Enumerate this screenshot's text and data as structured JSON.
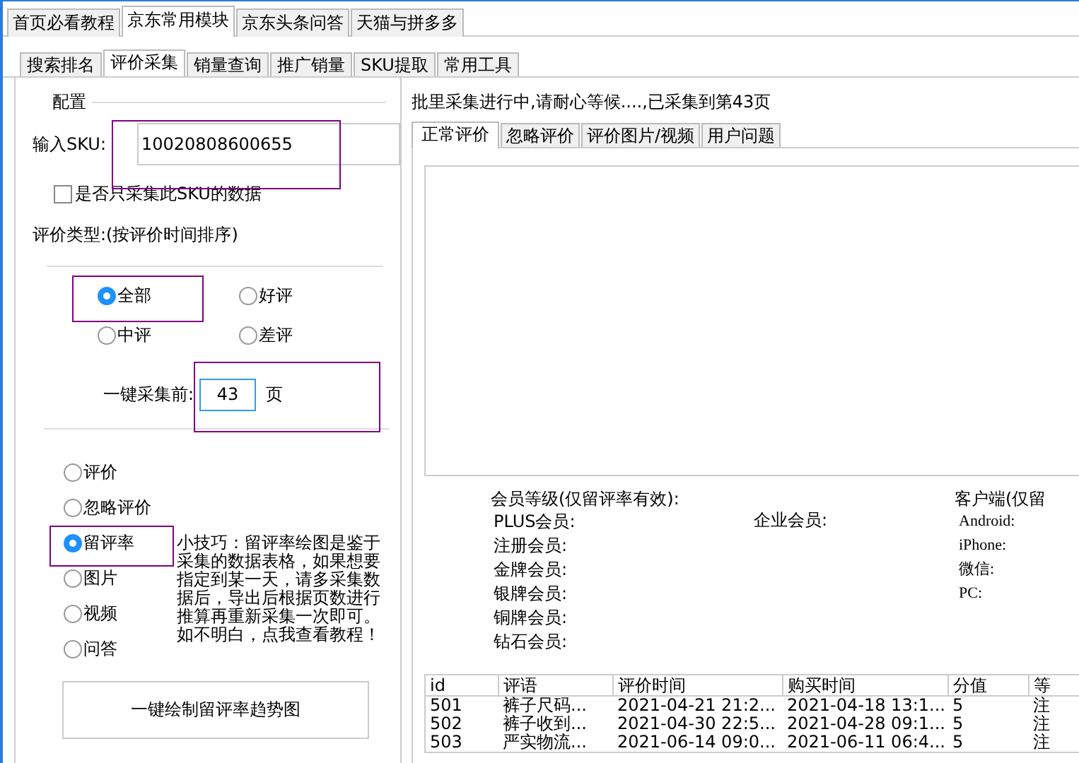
{
  "top_tabs": [
    {
      "label": "首页必看教程",
      "selected": false
    },
    {
      "label": "京东常用模块",
      "selected": true
    },
    {
      "label": "京东头条问答",
      "selected": false
    },
    {
      "label": "天猫与拼多多",
      "selected": false
    }
  ],
  "sub_tabs": [
    {
      "label": "搜索排名",
      "selected": false
    },
    {
      "label": "评价采集",
      "selected": true
    },
    {
      "label": "销量查询",
      "selected": false
    },
    {
      "label": "推广销量",
      "selected": false
    },
    {
      "label": "SKU提取",
      "selected": false
    },
    {
      "label": "常用工具",
      "selected": false
    }
  ],
  "config": {
    "title": "配置",
    "sku_label": "输入SKU:",
    "sku_value": "10020808600655",
    "sku_highlighted": true,
    "only_this_sku": {
      "label": "是否只采集此SKU的数据",
      "checked": false
    },
    "type_label": "评价类型:(按评价时间排序)",
    "types": [
      {
        "label": "全部",
        "selected": true,
        "highlighted": true
      },
      {
        "label": "好评",
        "selected": false,
        "highlighted": false
      },
      {
        "label": "中评",
        "selected": false,
        "highlighted": false
      },
      {
        "label": "差评",
        "selected": false,
        "highlighted": false
      }
    ],
    "pages_label": "一键采集前:",
    "pages_value": "43",
    "pages_unit": "页",
    "pages_highlighted": true
  },
  "modes": [
    {
      "label": "评价",
      "selected": false,
      "highlighted": false
    },
    {
      "label": "忽略评价",
      "selected": false,
      "highlighted": false
    },
    {
      "label": "留评率",
      "selected": true,
      "highlighted": true
    },
    {
      "label": "图片",
      "selected": false,
      "highlighted": false
    },
    {
      "label": "视频",
      "selected": false,
      "highlighted": false
    },
    {
      "label": "问答",
      "selected": false,
      "highlighted": false
    }
  ],
  "tip": "小技巧：留评率绘图是鉴于采集的数据表格，如果想要指定到某一天，请多采集数据后，导出后根据页数进行推算再重新采集一次即可。如不明白，点我查看教程！",
  "draw_button": "一键绘制留评率趋势图",
  "status": "批里采集进行中,请耐心等候....,已采集到第43页",
  "result_tabs": [
    {
      "label": "正常评价",
      "selected": true
    },
    {
      "label": "忽略评价",
      "selected": false
    },
    {
      "label": "评价图片/视频",
      "selected": false
    },
    {
      "label": "用户问题",
      "selected": false
    }
  ],
  "member_title": "会员等级(仅留评率有效):",
  "members": [
    "PLUS会员:",
    "注册会员:",
    "金牌会员:",
    "银牌会员:",
    "铜牌会员:",
    "钻石会员:"
  ],
  "enterprise": "企业会员:",
  "client_title": "客户端(仅留",
  "clients": [
    "Android:",
    "iPhone:",
    "微信:",
    "PC:"
  ],
  "table": {
    "columns": [
      "id",
      "评语",
      "评价时间",
      "购买时间",
      "分值",
      "等"
    ],
    "rows": [
      [
        "501",
        "裤子尺码...",
        "2021-04-21 21:2...",
        "2021-04-18 13:1...",
        "5",
        "注"
      ],
      [
        "502",
        "裤子收到...",
        "2021-04-30 22:5...",
        "2021-04-28 09:1...",
        "5",
        "注"
      ],
      [
        "503",
        "严实物流...",
        "2021-06-14 09:0...",
        "2021-06-11 06:4...",
        "5",
        "注"
      ]
    ]
  }
}
